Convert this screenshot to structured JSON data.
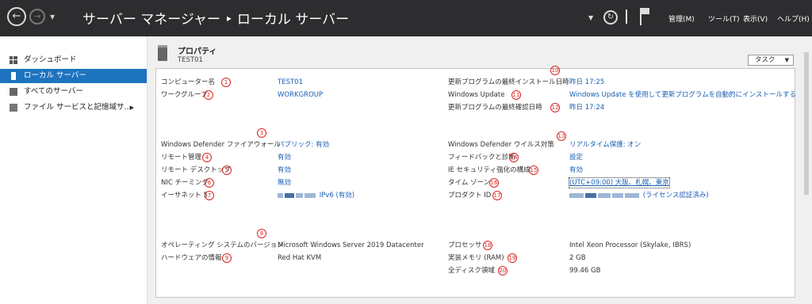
{
  "titlebar": {
    "title": "サーバー マネージャー ‣ ローカル サーバー",
    "menu": [
      "管理(M)",
      "ツール(T)",
      "表示(V)",
      "ヘルプ(H)"
    ]
  },
  "sidebar": {
    "items": [
      {
        "label": "ダッシュボード"
      },
      {
        "label": "ローカル サーバー"
      },
      {
        "label": "すべてのサーバー"
      },
      {
        "label": "ファイル サービスと記憶域サ..."
      }
    ]
  },
  "properties": {
    "title": "プロパティ",
    "subtitle": "TEST01",
    "tasks_label": "タスク"
  },
  "left": [
    {
      "num": "1",
      "label": "コンピューター名",
      "value": "TEST01"
    },
    {
      "num": "2",
      "label": "ワークグループ",
      "value": "WORKGROUP"
    },
    {
      "num": "3",
      "label": "Windows Defender ファイアウォール",
      "value": "パブリック: 有効"
    },
    {
      "num": "4",
      "label": "リモート管理",
      "value": "有効"
    },
    {
      "num": "5",
      "label": "リモート デスクトップ",
      "value": "有効"
    },
    {
      "num": "6",
      "label": "NIC チーミング",
      "value": "無効"
    },
    {
      "num": "7",
      "label": "イーサネット 5",
      "value": "IPv6 (有効)"
    },
    {
      "num": "8",
      "label": "オペレーティング システムのバージョン",
      "value": "Microsoft Windows Server 2019 Datacenter"
    },
    {
      "num": "9",
      "label": "ハードウェアの情報",
      "value": "Red Hat KVM"
    }
  ],
  "right": [
    {
      "num": "10",
      "label": "更新プログラムの最終インストール日時",
      "value": "昨日 17:25"
    },
    {
      "num": "11",
      "label": "Windows Update",
      "value": "Windows Update を使用して更新プログラムを自動的にインストールする"
    },
    {
      "num": "12",
      "label": "更新プログラムの最終確認日時",
      "value": "昨日 17:24"
    },
    {
      "num": "13",
      "label": "Windows Defender ウイルス対策",
      "value": "リアルタイム保護: オン"
    },
    {
      "num": "14",
      "label": "フィードバックと診断",
      "value": "設定"
    },
    {
      "num": "15",
      "label": "IE セキュリティ強化の構成",
      "value": "有効"
    },
    {
      "num": "16",
      "label": "タイム ゾーン",
      "value": "(UTC+09:00) 大阪、札幌、東京"
    },
    {
      "num": "17",
      "label": "プロダクト ID",
      "value": "(ライセンス認証済み)"
    },
    {
      "num": "18",
      "label": "プロセッサ",
      "value": "Intel Xeon Processor (Skylake, IBRS)"
    },
    {
      "num": "19",
      "label": "実装メモリ (RAM)",
      "value": "2 GB"
    },
    {
      "num": "20",
      "label": "全ディスク領域",
      "value": "99.46 GB"
    }
  ]
}
